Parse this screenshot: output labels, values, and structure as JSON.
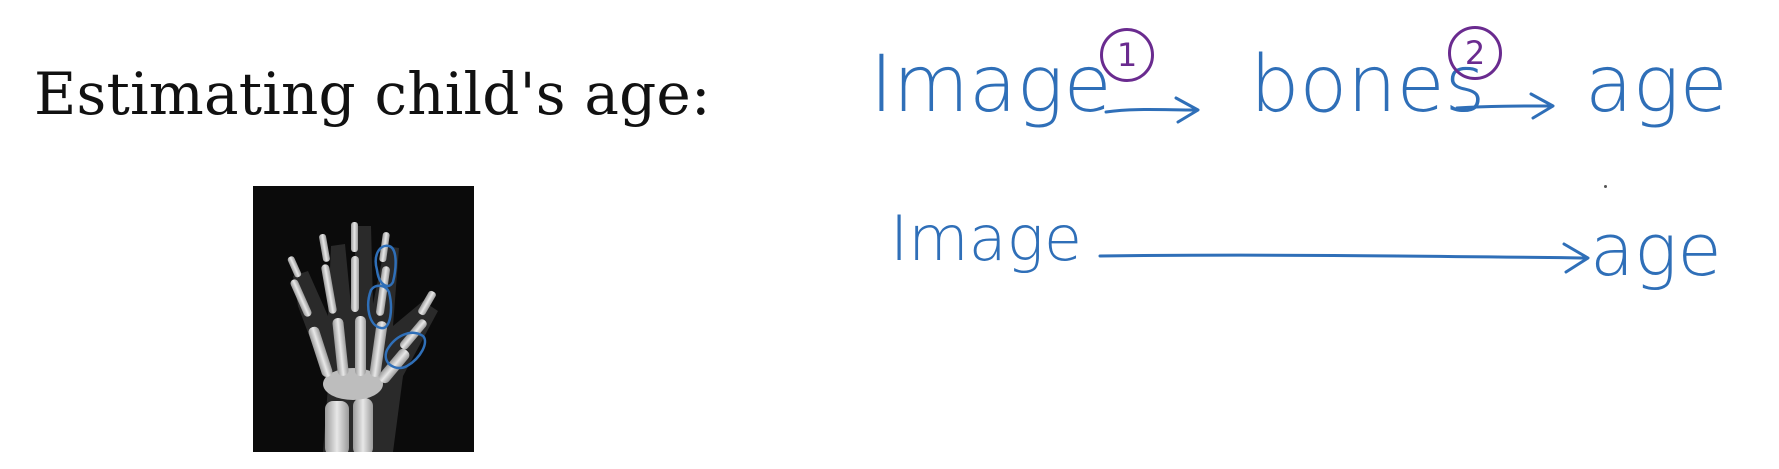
{
  "slide": {
    "title": "Estimating child's age:"
  },
  "pipeline_multi_step": {
    "input_label": "Image",
    "step1_number": "1",
    "intermediate_label": "bones",
    "step2_number": "2",
    "output_label": "age"
  },
  "pipeline_end_to_end": {
    "input_label": "Image",
    "output_label": "age"
  },
  "colors": {
    "ink_blue": "#2f6fb8",
    "ink_purple": "#6a2b8f",
    "title_text": "#111111"
  }
}
